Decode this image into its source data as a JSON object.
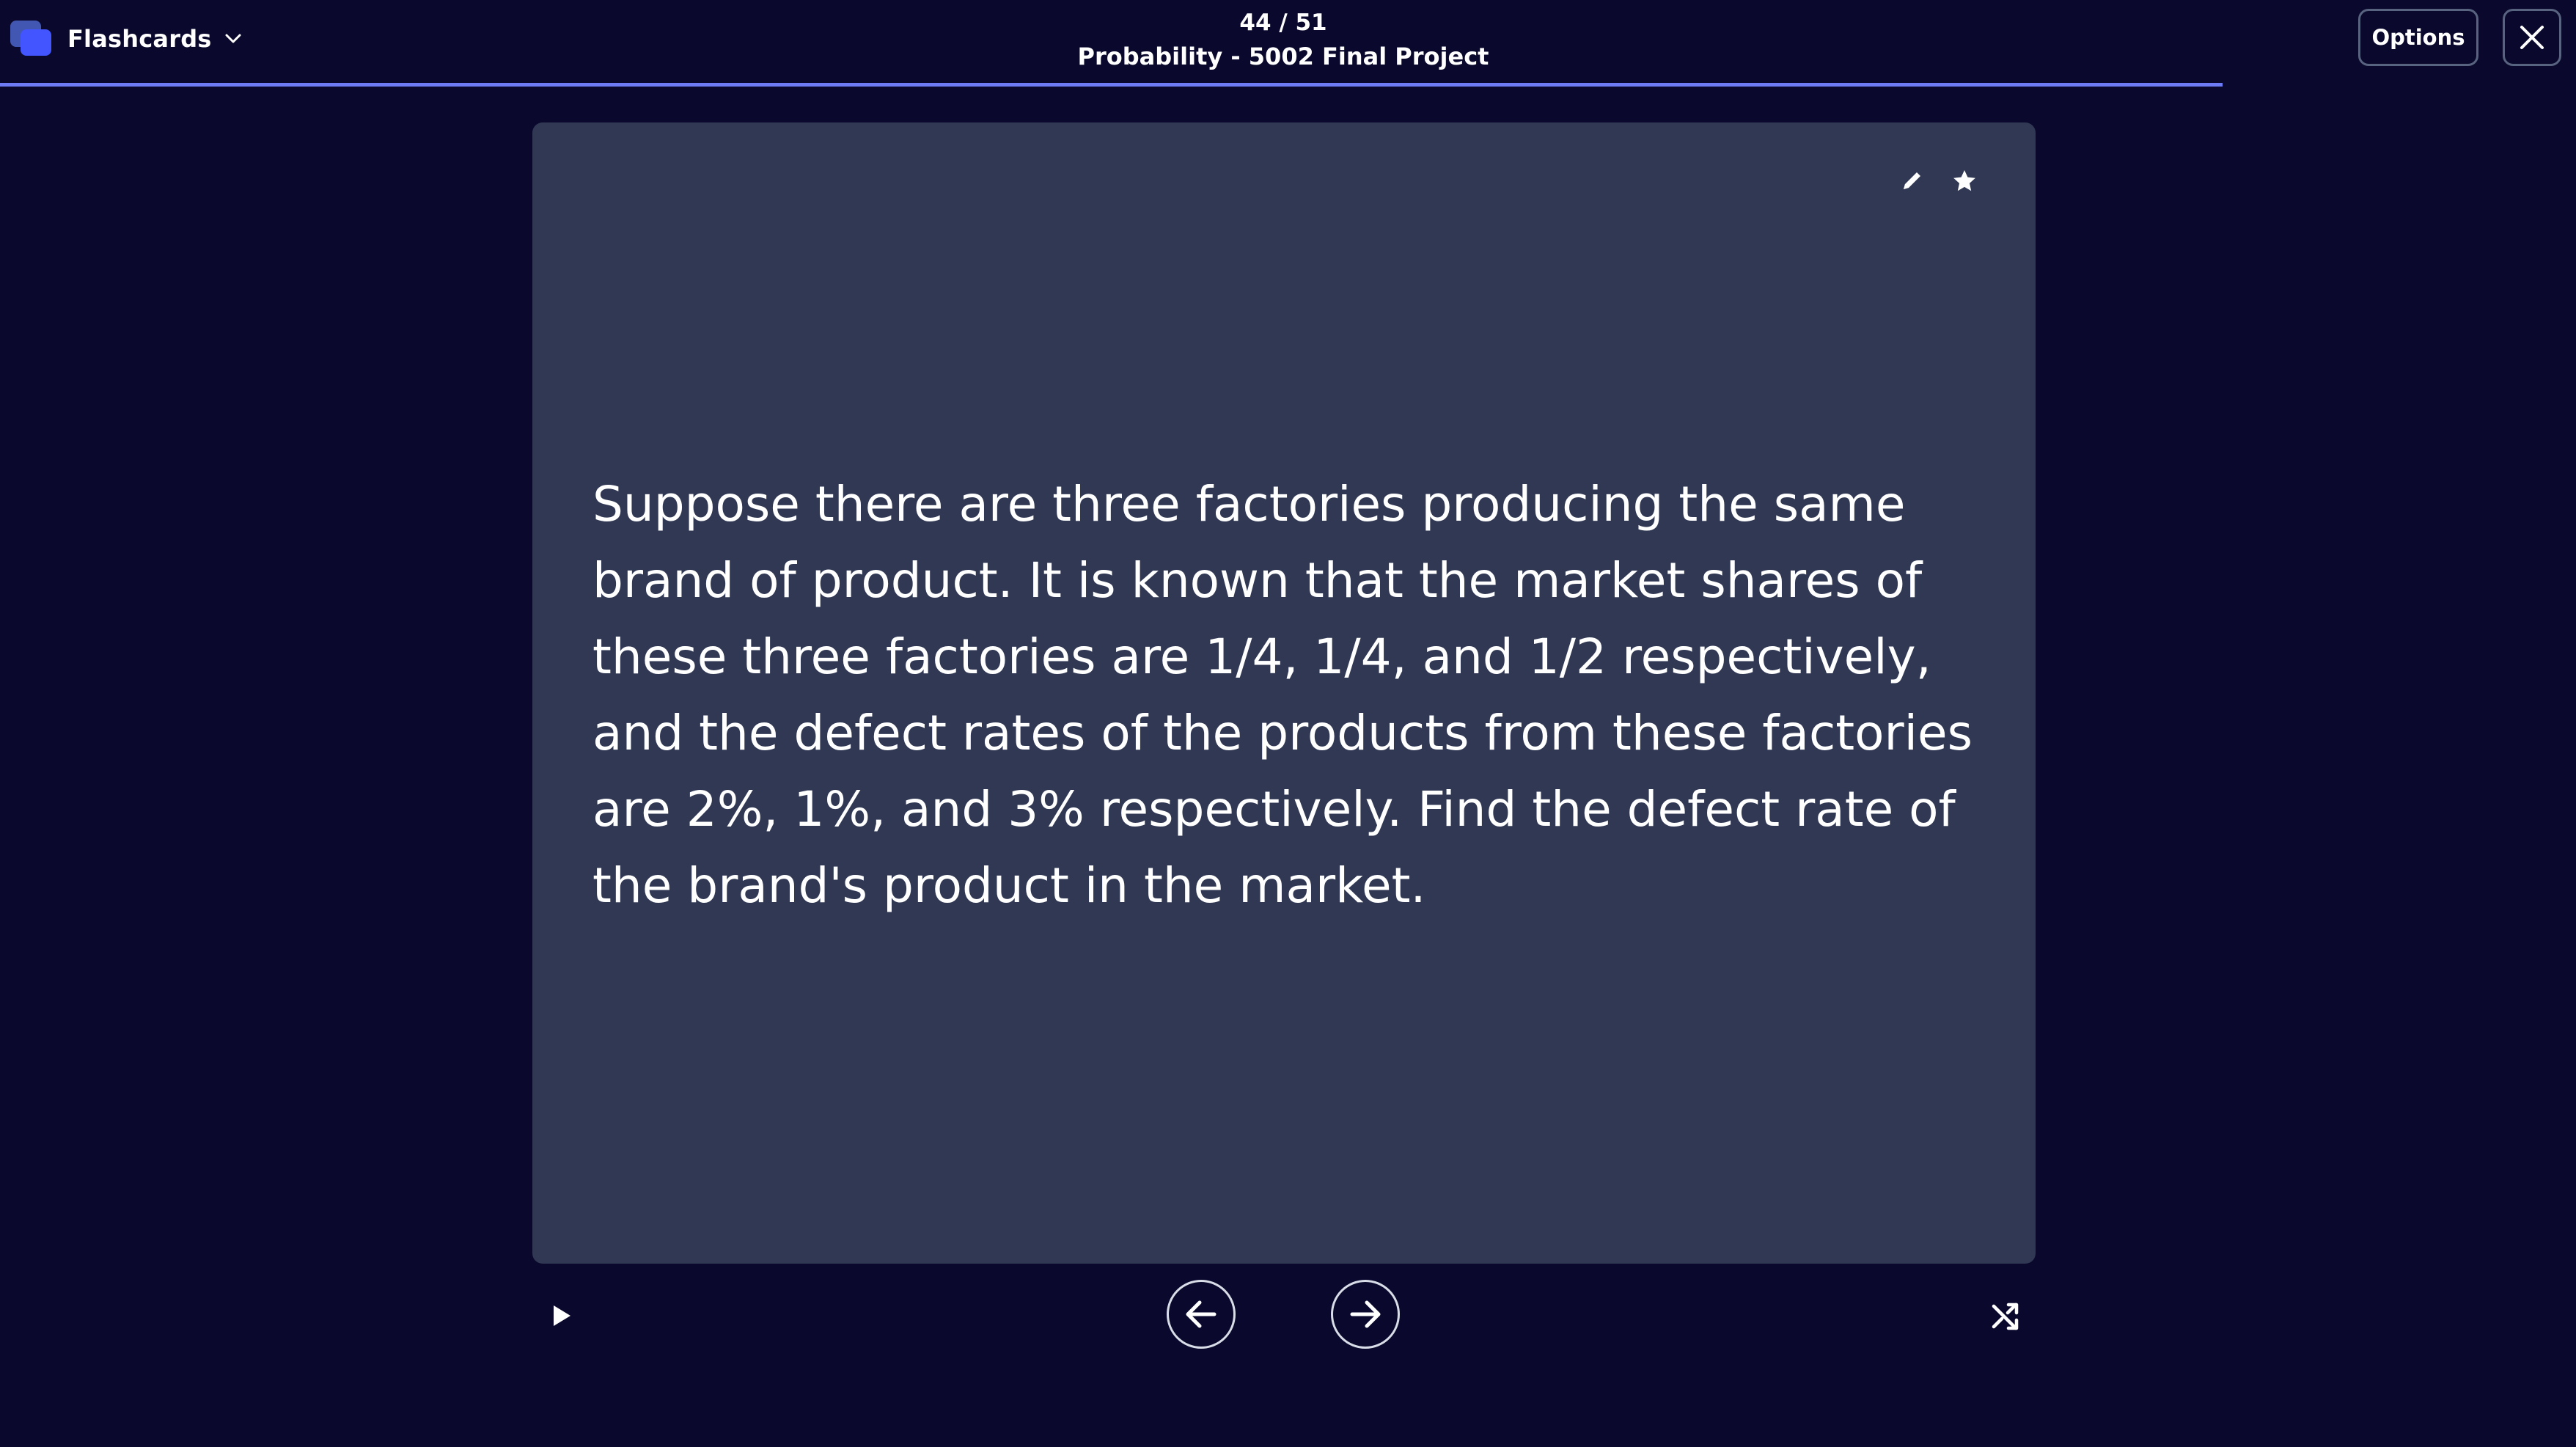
{
  "header": {
    "mode_label": "Flashcards",
    "mode_icon": "flashcards-icon",
    "progress_counter": "44 / 51",
    "progress_fraction": 0.8627,
    "set_title": "Probability - 5002 Final Project",
    "options_label": "Options",
    "close_icon": "close-icon"
  },
  "card": {
    "term": "Suppose there are three factories producing the same brand of product. It is known that the market shares of these three factories are 1/4, 1/4, and 1/2 respectively, and the defect rates of the products from these factories are 2%, 1%, and 3% respectively. Find the defect rate of the brand's product in the market.",
    "icons": [
      "edit-icon",
      "star-icon"
    ]
  },
  "controls": {
    "icons": [
      "play-icon",
      "arrow-left-icon",
      "arrow-right-icon",
      "shuffle-icon"
    ]
  },
  "colors": {
    "background": "#0a092d",
    "card": "#303854",
    "accent": "#4255ff",
    "progress": "#6d7cf5",
    "border": "#586380"
  }
}
